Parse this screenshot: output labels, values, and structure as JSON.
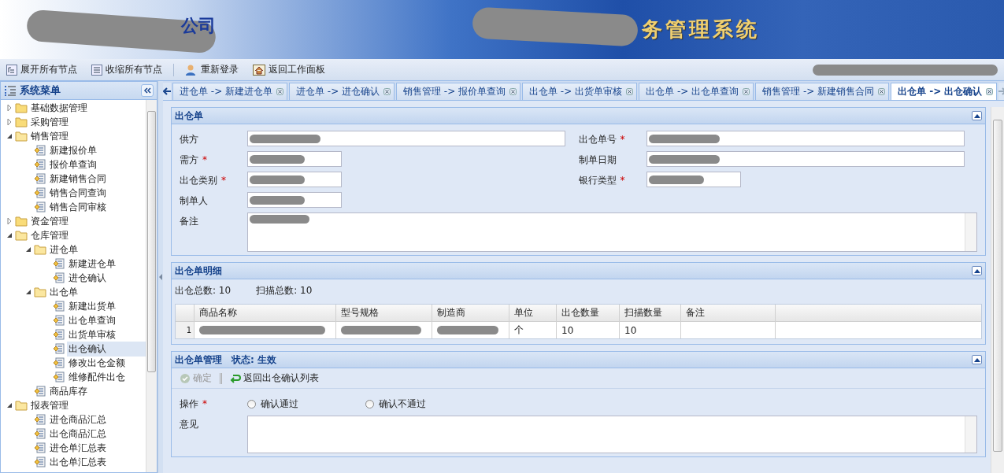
{
  "header": {
    "title_left": "公司",
    "title_right": "务管理系统",
    "redacted": true
  },
  "toolbar": [
    {
      "label": "展开所有节点",
      "kind": "expand"
    },
    {
      "label": "收缩所有节点",
      "kind": "collapse"
    },
    {
      "label": "重新登录",
      "kind": "relogin"
    },
    {
      "label": "返回工作面板",
      "kind": "home"
    }
  ],
  "user_info": {
    "redacted": true
  },
  "sidebar": {
    "title": "系统菜单",
    "items": [
      {
        "label": "基础数据管理",
        "kind": "folder",
        "expanded": false,
        "selected": false
      },
      {
        "label": "采购管理",
        "kind": "folder",
        "expanded": false,
        "selected": false
      },
      {
        "label": "销售管理",
        "kind": "folder",
        "expanded": true,
        "selected": false,
        "children": [
          {
            "label": "新建报价单",
            "kind": "page",
            "selected": false
          },
          {
            "label": "报价单查询",
            "kind": "page",
            "selected": false
          },
          {
            "label": "新建销售合同",
            "kind": "page",
            "selected": false
          },
          {
            "label": "销售合同查询",
            "kind": "page",
            "selected": false
          },
          {
            "label": "销售合同审核",
            "kind": "page",
            "selected": false
          }
        ]
      },
      {
        "label": "资金管理",
        "kind": "folder",
        "expanded": false,
        "selected": false
      },
      {
        "label": "仓库管理",
        "kind": "folder",
        "expanded": true,
        "selected": false,
        "children": [
          {
            "label": "进仓单",
            "kind": "folder",
            "expanded": true,
            "selected": false,
            "children": [
              {
                "label": "新建进仓单",
                "kind": "page",
                "selected": false
              },
              {
                "label": "进仓确认",
                "kind": "page",
                "selected": false
              }
            ]
          },
          {
            "label": "出仓单",
            "kind": "folder",
            "expanded": true,
            "selected": false,
            "children": [
              {
                "label": "新建出货单",
                "kind": "page",
                "selected": false
              },
              {
                "label": "出仓单查询",
                "kind": "page",
                "selected": false
              },
              {
                "label": "出货单审核",
                "kind": "page",
                "selected": false
              },
              {
                "label": "出仓确认",
                "kind": "page",
                "selected": true
              },
              {
                "label": "修改出仓金额",
                "kind": "page",
                "selected": false
              },
              {
                "label": "维修配件出仓",
                "kind": "page",
                "selected": false
              }
            ]
          },
          {
            "label": "商品库存",
            "kind": "page",
            "selected": false
          }
        ]
      },
      {
        "label": "报表管理",
        "kind": "folder",
        "expanded": true,
        "selected": false,
        "children": [
          {
            "label": "进仓商品汇总",
            "kind": "page",
            "selected": false
          },
          {
            "label": "出仓商品汇总",
            "kind": "page",
            "selected": false
          },
          {
            "label": "进仓单汇总表",
            "kind": "page",
            "selected": false
          },
          {
            "label": "出仓单汇总表",
            "kind": "page",
            "selected": false
          }
        ]
      }
    ]
  },
  "tabs": [
    {
      "label": "进仓单 -> 新建进仓单",
      "selected": false
    },
    {
      "label": "进仓单 -> 进仓确认",
      "selected": false
    },
    {
      "label": "销售管理 -> 报价单查询",
      "selected": false
    },
    {
      "label": "出仓单 -> 出货单审核",
      "selected": false
    },
    {
      "label": "出仓单 -> 出仓单查询",
      "selected": false
    },
    {
      "label": "销售管理 -> 新建销售合同",
      "selected": false
    },
    {
      "label": "出仓单 -> 出仓确认",
      "selected": true
    }
  ],
  "order_panel": {
    "title": "出仓单",
    "rows": [
      [
        {
          "label": "供方",
          "redacted": true
        },
        {
          "label": "出仓单号",
          "required_mark": "*",
          "redacted": true
        }
      ],
      [
        {
          "label": "需方",
          "required_mark": "*",
          "redacted": true
        },
        {
          "label": "制单日期",
          "redacted": true
        }
      ],
      [
        {
          "label": "出仓类别",
          "required_mark": "*",
          "redacted": true
        },
        {
          "label": "银行类型",
          "required_mark": "*",
          "redacted": true
        }
      ],
      [
        {
          "label": "制单人",
          "redacted": true
        }
      ]
    ],
    "notes": {
      "label": "备注",
      "redacted": true
    }
  },
  "detail_panel": {
    "title": "出仓单明细",
    "summary": [
      "出仓总数: 10",
      "扫描总数: 10"
    ],
    "columns": [
      "商品名称",
      "型号规格",
      "制造商",
      "单位",
      "出仓数量",
      "扫描数量",
      "备注"
    ],
    "rows": [
      {
        "number": "1",
        "cells": [
          {
            "redacted": true
          },
          {
            "redacted": true
          },
          {
            "redacted": true
          },
          {
            "text": "个"
          },
          {
            "text": "10"
          },
          {
            "text": "10"
          },
          {
            "redacted": false
          }
        ]
      }
    ]
  },
  "manage_panel": {
    "title": "出仓单管理",
    "status": "状态: 生效",
    "buttons": [
      {
        "label": "确定",
        "kind": "confirm",
        "disabled": true
      },
      {
        "label": "返回出仓确认列表",
        "kind": "back",
        "disabled": false
      }
    ],
    "operation": {
      "label": "操作",
      "required_mark": "*",
      "options": [
        {
          "label": "确认通过",
          "selected": false
        },
        {
          "label": "确认不通过",
          "selected": false
        }
      ]
    },
    "opinion": {
      "label": "意见"
    }
  }
}
